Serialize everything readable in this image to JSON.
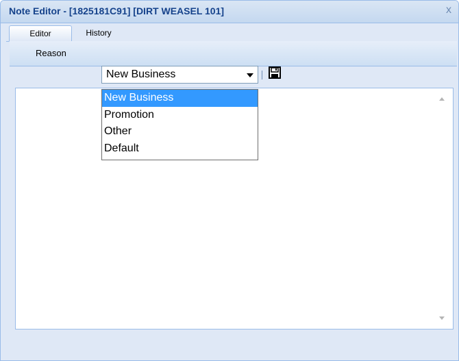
{
  "window": {
    "title": "Note Editor - [1825181C91] [DIRT WEASEL 101]",
    "close_glyph": "x"
  },
  "tabs": [
    {
      "label": "Editor",
      "active": true
    },
    {
      "label": "History",
      "active": false
    }
  ],
  "toolbar": {
    "reason_label": "Reason",
    "reason_value": "New Business",
    "save_icon": "save-icon"
  },
  "dropdown": {
    "options": [
      "New Business",
      "Promotion",
      "Other",
      "Default"
    ],
    "selected_index": 0
  },
  "colors": {
    "title_text": "#15428b",
    "panel_bg": "#dfe8f6",
    "border": "#99bbe8",
    "selection": "#3399ff"
  }
}
